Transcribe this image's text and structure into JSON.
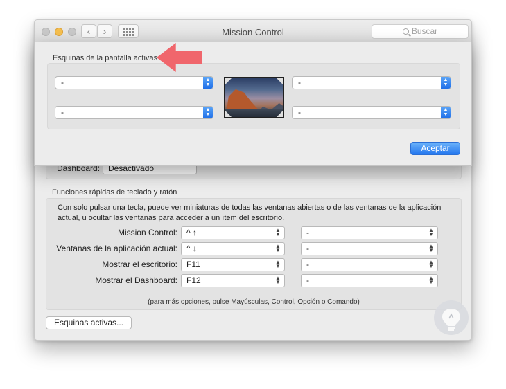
{
  "window": {
    "title": "Mission Control",
    "search_placeholder": "Buscar",
    "back_glyph": "‹",
    "forward_glyph": "›"
  },
  "background": {
    "dashboard_label": "Dashboard:",
    "dashboard_value": "Desactivado"
  },
  "shortcuts": {
    "section_title": "Funciones rápidas de teclado y ratón",
    "description": "Con solo pulsar una tecla, puede ver miniaturas de todas las ventanas abiertas o de las ventanas de la aplicación actual, u ocultar las ventanas para acceder a un ítem del escritorio.",
    "rows": [
      {
        "label": "Mission Control:",
        "keyboard": "^ ↑",
        "mouse": "-"
      },
      {
        "label": "Ventanas de la aplicación actual:",
        "keyboard": "^ ↓",
        "mouse": "-"
      },
      {
        "label": "Mostrar el escritorio:",
        "keyboard": "F11",
        "mouse": "-"
      },
      {
        "label": "Mostrar el Dashboard:",
        "keyboard": "F12",
        "mouse": "-"
      }
    ],
    "note": "(para más opciones, pulse Mayúsculas, Control, Opción o Comando)",
    "hot_corners_button": "Esquinas activas..."
  },
  "sheet": {
    "title": "Esquinas de la pantalla activas",
    "corners": {
      "top_left": "-",
      "top_right": "-",
      "bottom_left": "-",
      "bottom_right": "-"
    },
    "ok_button": "Aceptar"
  },
  "colors": {
    "accent_blue": "#2376ee",
    "annotation_arrow": "#f0666c"
  }
}
